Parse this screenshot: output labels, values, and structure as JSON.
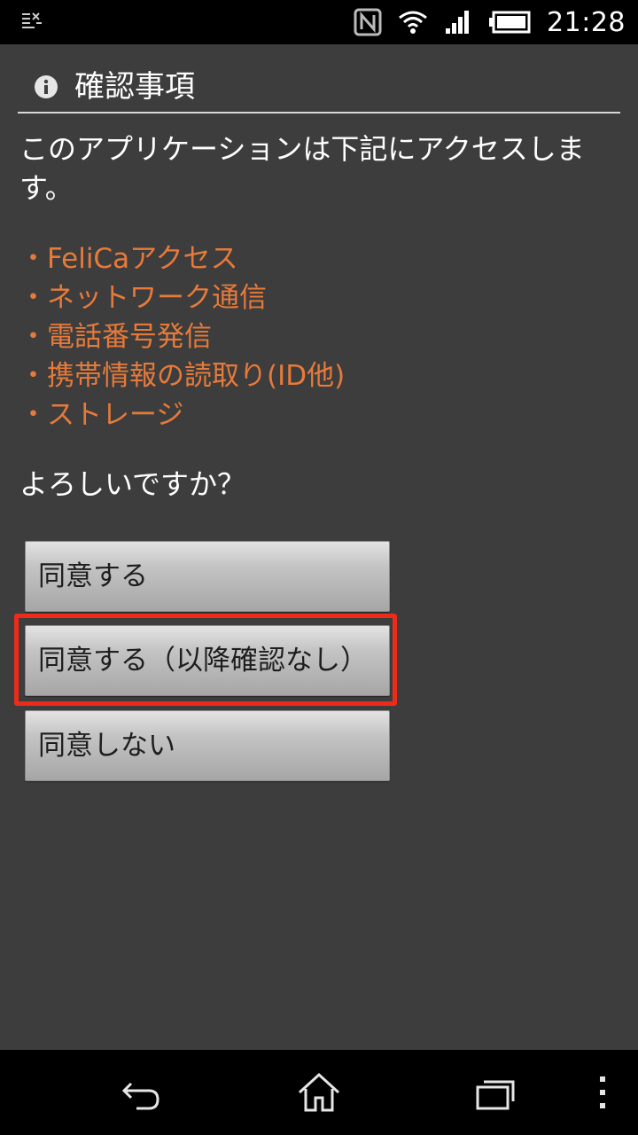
{
  "status_bar": {
    "time": "21:28",
    "icons": [
      "notification-icon",
      "nfc-icon",
      "wifi-icon",
      "signal-icon",
      "battery-icon"
    ]
  },
  "dialog": {
    "title": "確認事項",
    "message": "このアプリケーションは下記にアクセスします。",
    "permissions": [
      "・FeliCaアクセス",
      "・ネットワーク通信",
      "・電話番号発信",
      "・携帯情報の読取り(ID他)",
      "・ストレージ"
    ],
    "question": "よろしいですか？",
    "buttons": {
      "agree": "同意する",
      "agree_always": "同意する（以降確認なし）",
      "disagree": "同意しない"
    }
  },
  "colors": {
    "background": "#3d3d3d",
    "permission_text": "#e77a3a",
    "highlight": "#ee2b1a"
  },
  "nav_bar": {
    "icons": [
      "back-icon",
      "home-icon",
      "recent-apps-icon",
      "menu-icon"
    ]
  }
}
